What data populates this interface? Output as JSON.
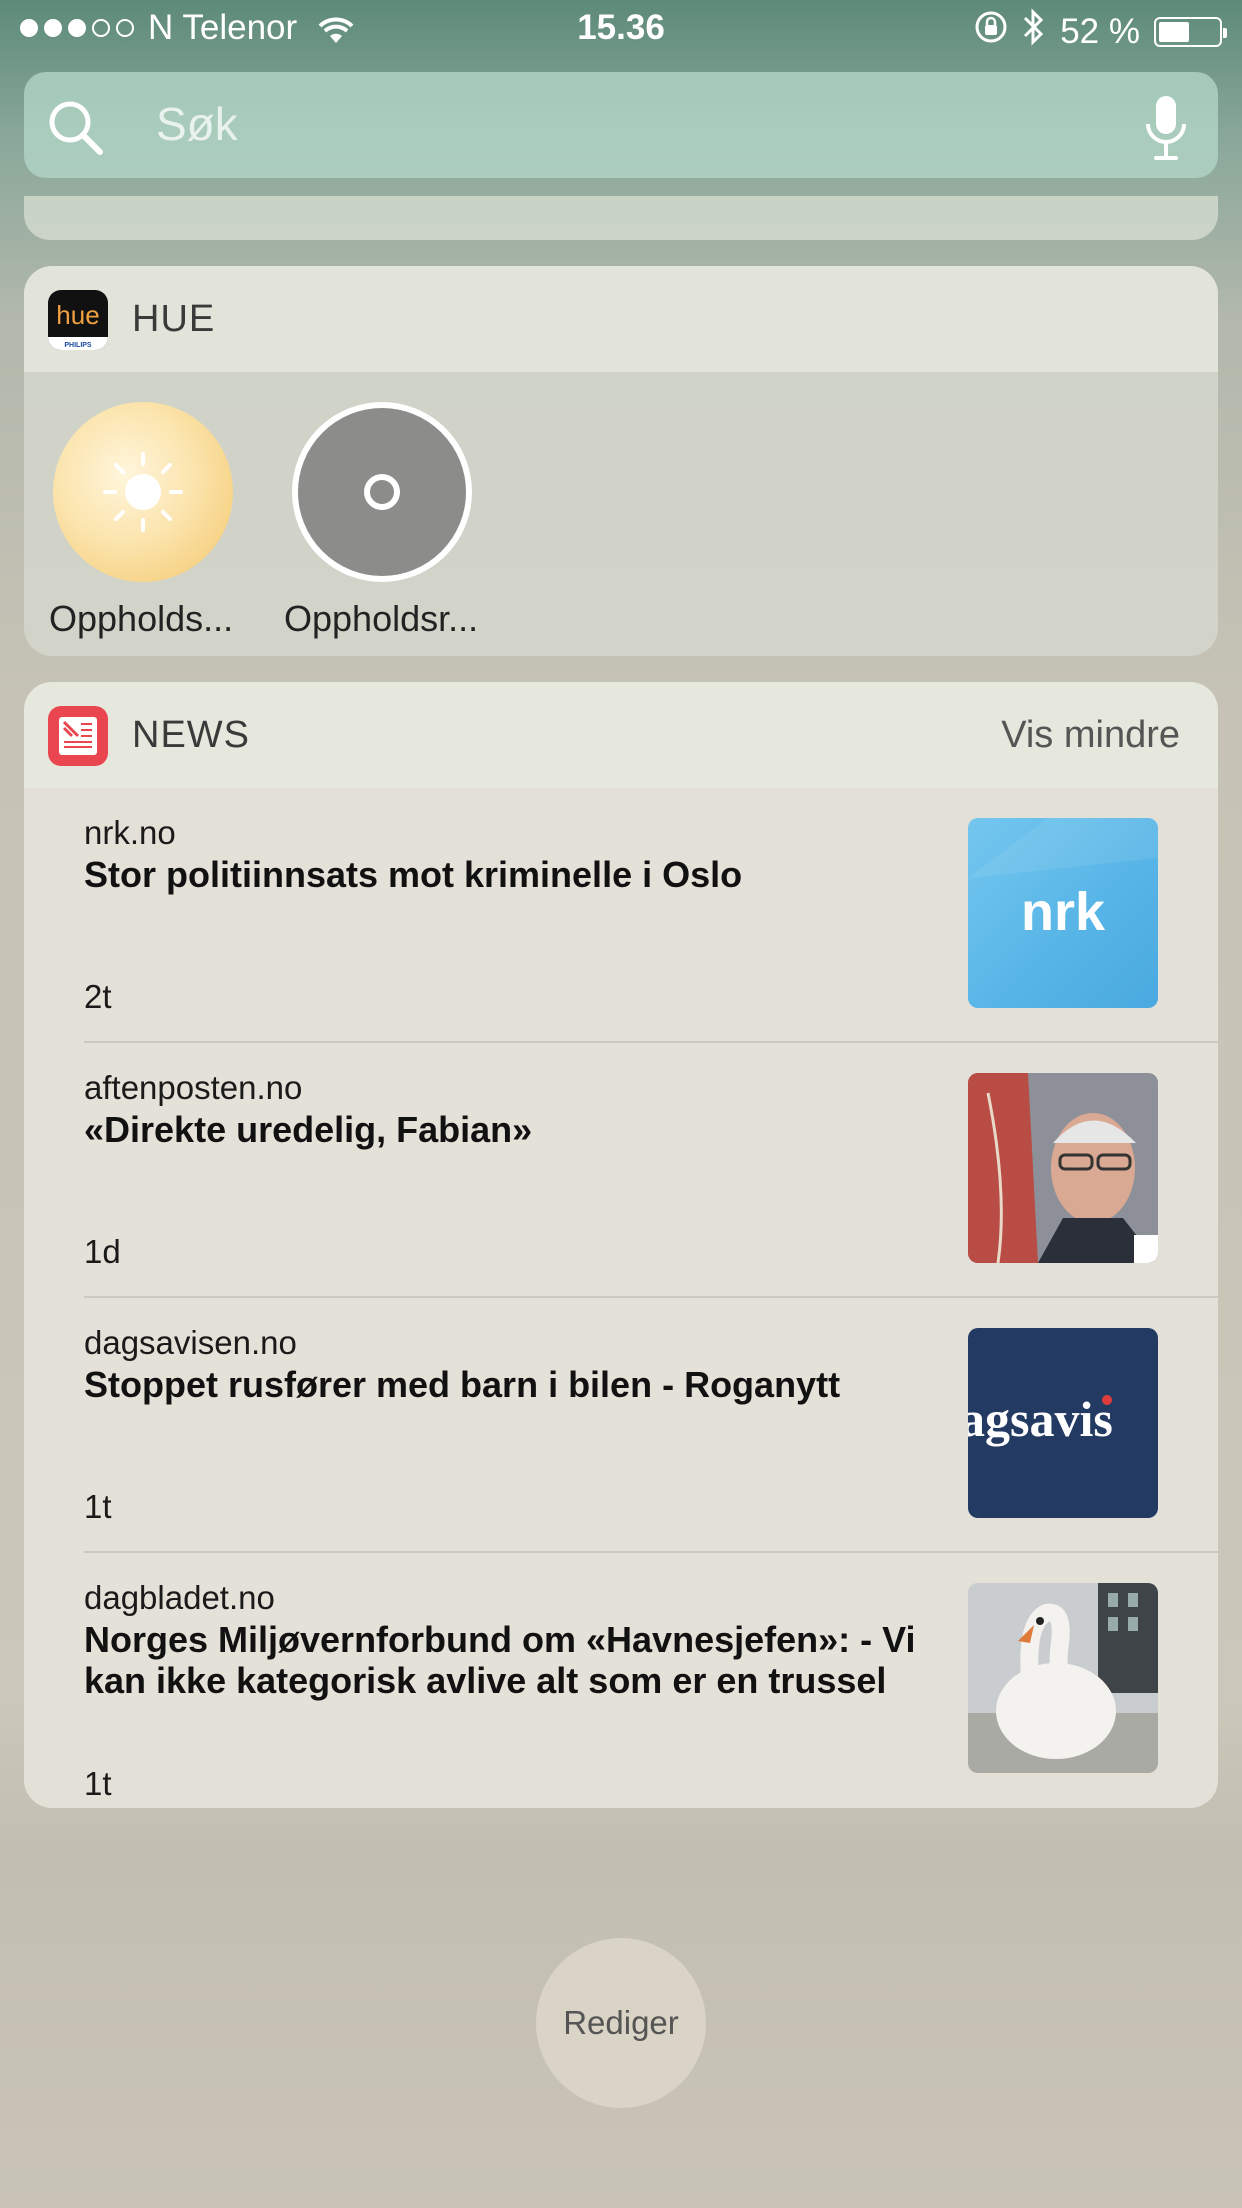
{
  "status_bar": {
    "signal_full": 3,
    "signal_total": 5,
    "carrier": "N Telenor",
    "time": "15.36",
    "battery_percent_text": "52 %",
    "battery_level": 0.52
  },
  "search": {
    "placeholder": "Søk"
  },
  "hue_widget": {
    "title": "HUE",
    "app_icon_text": "hue",
    "app_icon_brand": "PHILIPS",
    "scenes": [
      {
        "label": "Oppholds...",
        "state": "on",
        "icon": "sun-icon"
      },
      {
        "label": "Oppholdsr...",
        "state": "off",
        "icon": "power-ring-icon"
      }
    ]
  },
  "news_widget": {
    "title": "NEWS",
    "action_label": "Vis mindre",
    "items": [
      {
        "source": "nrk.no",
        "title": "Stor politiinnsats mot kriminelle i Oslo",
        "age": "2t",
        "thumb_text": "nrk",
        "thumb_color": "#5bb8e8"
      },
      {
        "source": "aftenposten.no",
        "title": "«Direkte uredelig, Fabian»",
        "age": "1d",
        "thumb_text": "",
        "thumb_color": "#8a8e95"
      },
      {
        "source": "dagsavisen.no",
        "title": "Stoppet rusfører med barn i bilen - Roganytt",
        "age": "1t",
        "thumb_text": "agsavis",
        "thumb_color": "#233a62"
      },
      {
        "source": "dagbladet.no",
        "title": "Norges Miljøvernforbund om «Havnesjefen»: - Vi kan ikke kategorisk avlive alt som er en trussel",
        "age": "1t",
        "thumb_text": "",
        "thumb_color": "#d8d8d4"
      }
    ]
  },
  "edit_button": {
    "label": "Rediger"
  },
  "colors": {
    "search_bg": "#b4d8c8",
    "widget_bg": "#e5e3da",
    "hue_on": "#f6d58a"
  }
}
